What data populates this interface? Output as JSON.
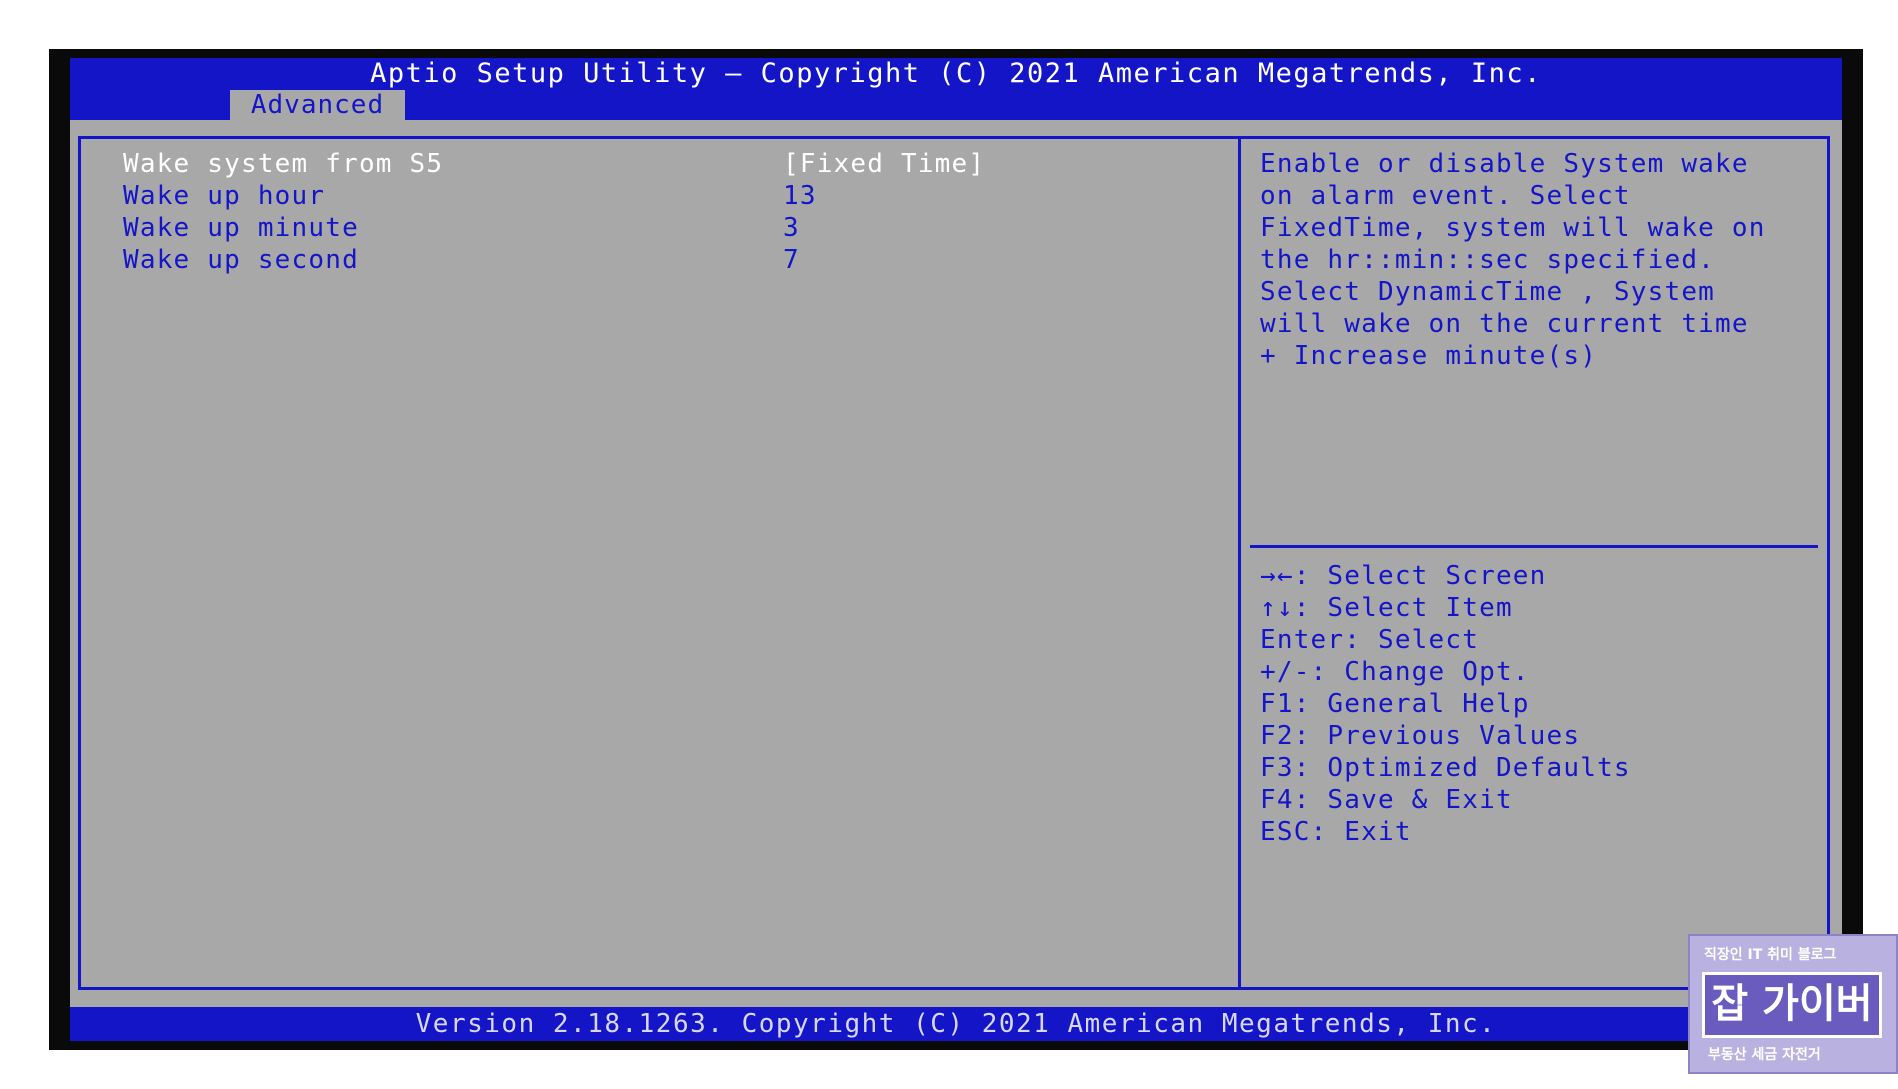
{
  "header": {
    "title": "Aptio Setup Utility – Copyright (C) 2021 American Megatrends, Inc.",
    "tabs": [
      {
        "label": "Advanced",
        "selected": true
      }
    ]
  },
  "settings": [
    {
      "label": "Wake system from S5",
      "value": "[Fixed Time]",
      "selected": true
    },
    {
      "label": "Wake up hour",
      "value": "13",
      "selected": false
    },
    {
      "label": "Wake up minute",
      "value": "3",
      "selected": false
    },
    {
      "label": "Wake up second",
      "value": "7",
      "selected": false
    }
  ],
  "help": {
    "lines": [
      "Enable or disable System wake",
      "on alarm event. Select",
      "FixedTime, system will wake on",
      "the hr::min::sec specified.",
      "Select DynamicTime , System",
      "will wake on the current time",
      "+ Increase minute(s)"
    ]
  },
  "keys": [
    "→←: Select Screen",
    "↑↓: Select Item",
    "Enter: Select",
    "+/-: Change Opt.",
    "F1: General Help",
    "F2: Previous Values",
    "F3: Optimized Defaults",
    "F4: Save & Exit",
    "ESC: Exit"
  ],
  "footer": {
    "version": "Version 2.18.1263. Copyright (C) 2021 American Megatrends, Inc."
  },
  "watermark": {
    "top": "직장인 IT 취미 블로그",
    "main": "잡 가이버",
    "bottom": "부동산 세금 자전거"
  },
  "colors": {
    "bar_blue": "#1515c8",
    "panel_gray": "#a8a8a8",
    "text_blue": "#1515c8",
    "selected_text": "#ffffff"
  }
}
